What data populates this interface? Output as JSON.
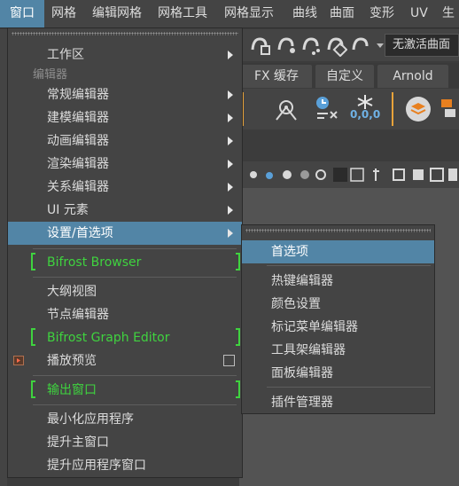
{
  "menubar": {
    "items": [
      "窗口",
      "网格",
      "编辑网格",
      "网格工具",
      "网格显示",
      "曲线",
      "曲面",
      "变形",
      "UV",
      "生"
    ]
  },
  "background": {
    "layout_dropdown": "无激活曲面",
    "tabs": [
      "FX 缓存",
      "自定义",
      "Arnold"
    ],
    "shelf_numbers": "0,0,0"
  },
  "main_menu": {
    "workspace": "工作区",
    "section_editors": "编辑器",
    "general_editors": "常规编辑器",
    "modeling_editors": "建模编辑器",
    "animation_editors": "动画编辑器",
    "rendering_editors": "渲染编辑器",
    "relationship_editors": "关系编辑器",
    "ui_elements": "UI 元素",
    "settings_prefs": "设置/首选项",
    "bifrost_browser": "Bifrost Browser",
    "outliner": "大纲视图",
    "node_editor": "节点编辑器",
    "bifrost_graph_editor": "Bifrost Graph Editor",
    "playblast": "播放预览",
    "output_window": "输出窗口",
    "minimize_app": "最小化应用程序",
    "raise_main": "提升主窗口",
    "raise_app": "提升应用程序窗口"
  },
  "sub_menu": {
    "preferences": "首选项",
    "hotkey_editor": "热键编辑器",
    "color_settings": "颜色设置",
    "marking_menu_editor": "标记菜单编辑器",
    "shelf_editor": "工具架编辑器",
    "panel_editor": "面板编辑器",
    "plugin_manager": "插件管理器"
  },
  "colors": {
    "highlight": "#5285a6",
    "bifrost_green": "#3fd33f",
    "menu_bg": "#444444"
  }
}
